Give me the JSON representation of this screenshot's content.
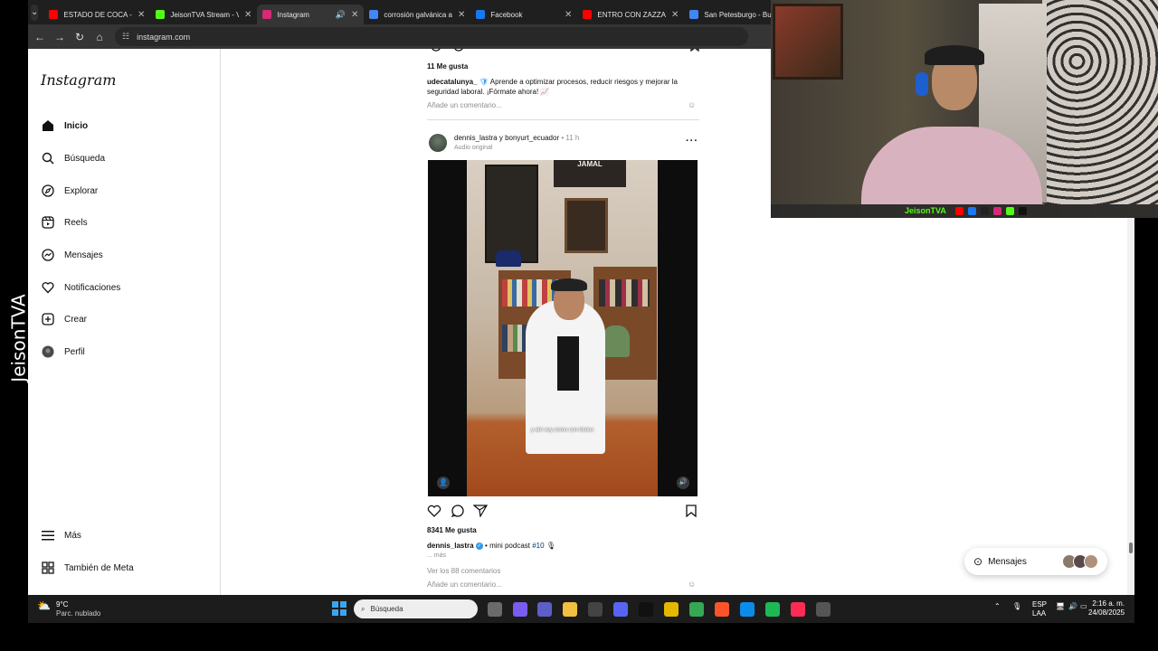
{
  "streamer_vertical_text": "JeisonTVA",
  "browser": {
    "tabs": [
      {
        "title": "ESTADO DE COCA - Y",
        "color": "#ff0000",
        "active": false,
        "sound": false
      },
      {
        "title": "JeisonTVA Stream - V",
        "color": "#53fc18",
        "active": false,
        "sound": false
      },
      {
        "title": "Instagram",
        "color": "#d62976",
        "active": true,
        "sound": true
      },
      {
        "title": "corrosión galvánica a",
        "color": "#4285f4",
        "active": false,
        "sound": false
      },
      {
        "title": "Facebook",
        "color": "#1877f2",
        "active": false,
        "sound": false
      },
      {
        "title": "ENTRO CON ZAZZA ...",
        "color": "#ff0000",
        "active": false,
        "sound": false
      },
      {
        "title": "San Petesburgo - Bu",
        "color": "#4285f4",
        "active": false,
        "sound": false
      }
    ],
    "url": "instagram.com"
  },
  "instagram": {
    "logo": "Instagram",
    "nav": [
      {
        "label": "Inicio",
        "icon": "home-icon",
        "bold": true
      },
      {
        "label": "Búsqueda",
        "icon": "search-icon"
      },
      {
        "label": "Explorar",
        "icon": "compass-icon"
      },
      {
        "label": "Reels",
        "icon": "reels-icon"
      },
      {
        "label": "Mensajes",
        "icon": "messenger-icon"
      },
      {
        "label": "Notificaciones",
        "icon": "heart-icon"
      },
      {
        "label": "Crear",
        "icon": "plus-square-icon"
      },
      {
        "label": "Perfil",
        "icon": "avatar-icon"
      }
    ],
    "more": "Más",
    "meta": "También de Meta",
    "prev_post": {
      "likes": "11 Me gusta",
      "username": "udecatalunya_",
      "caption": "Aprende a optimizar procesos, reducir riesgos y mejorar la seguridad laboral. ¡Fórmate ahora! 📈",
      "comment_placeholder": "Añade un comentario..."
    },
    "post": {
      "user1": "dennis_lastra",
      "connector": "y",
      "user2": "bonyurt_ecuador",
      "time": "11 h",
      "audio": "Audio original",
      "poster_text": "JAMAL",
      "subtitle": "y ahí voy como con títulos",
      "likes": "8341 Me gusta",
      "caption_user": "dennis_lastra",
      "caption": "mini podcast",
      "hashtag": "#10",
      "more": "... más",
      "view_comments": "Ver los 88 comentarios",
      "comment_placeholder": "Añade un comentario..."
    },
    "messages_label": "Mensajes"
  },
  "webcam": {
    "overlay_name": "JeisonTVA"
  },
  "taskbar": {
    "weather_temp": "9°C",
    "weather_desc": "Parc. nublado",
    "search_placeholder": "Búsqueda",
    "lang1": "ESP",
    "lang2": "LAA",
    "time": "2:16 a. m.",
    "date": "24/08/2025",
    "icons": [
      {
        "name": "file-explorer-tb-icon",
        "color": "#6b6b6b"
      },
      {
        "name": "copilot-icon",
        "color": "#7a5cf0"
      },
      {
        "name": "teams-icon",
        "color": "#5b5fc7"
      },
      {
        "name": "folder-icon",
        "color": "#f2c040"
      },
      {
        "name": "chatgpt-icon",
        "color": "#444444"
      },
      {
        "name": "discord-icon",
        "color": "#5865f2"
      },
      {
        "name": "tiktok-icon",
        "color": "#111111"
      },
      {
        "name": "app-yellow-icon",
        "color": "#e5b700"
      },
      {
        "name": "chrome-icon",
        "color": "#34a853"
      },
      {
        "name": "brave-icon",
        "color": "#fb542b"
      },
      {
        "name": "edge-icon",
        "color": "#0c8ce9"
      },
      {
        "name": "spotify-icon",
        "color": "#1db954"
      },
      {
        "name": "tiktok-live-icon",
        "color": "#fe2c55"
      },
      {
        "name": "obs-icon",
        "color": "#555555"
      }
    ]
  }
}
